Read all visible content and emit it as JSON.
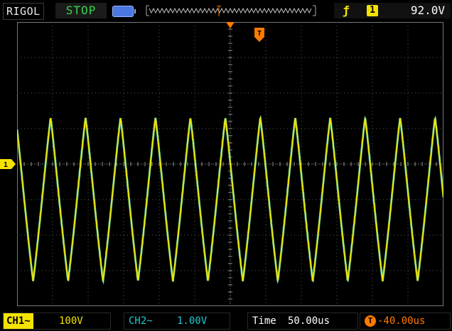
{
  "topbar": {
    "brand": "RIGOL",
    "run_state": "STOP",
    "trigger_edge_icon": "rising-edge-icon",
    "trigger_source": "1",
    "trigger_level": "92.0V"
  },
  "markers": {
    "trigger_flag": "T",
    "ch1_ground": "1"
  },
  "bottombar": {
    "ch1_label": "CH1",
    "ch1_scale": "100V",
    "ch2_label": "CH2",
    "ch2_scale": "1.00V",
    "time_label": "Time",
    "time_value": "50.00us",
    "trigger_offset": "-40.00us"
  },
  "colors": {
    "ch1": "#f4e300",
    "ch2": "#20c8d6",
    "trigger": "#ff7a00",
    "grid": "#5a5a5a"
  },
  "waveform": {
    "cycles_on_screen": 12.2,
    "high_level_divisions": 1.3,
    "low_level_divisions": -3.3
  }
}
